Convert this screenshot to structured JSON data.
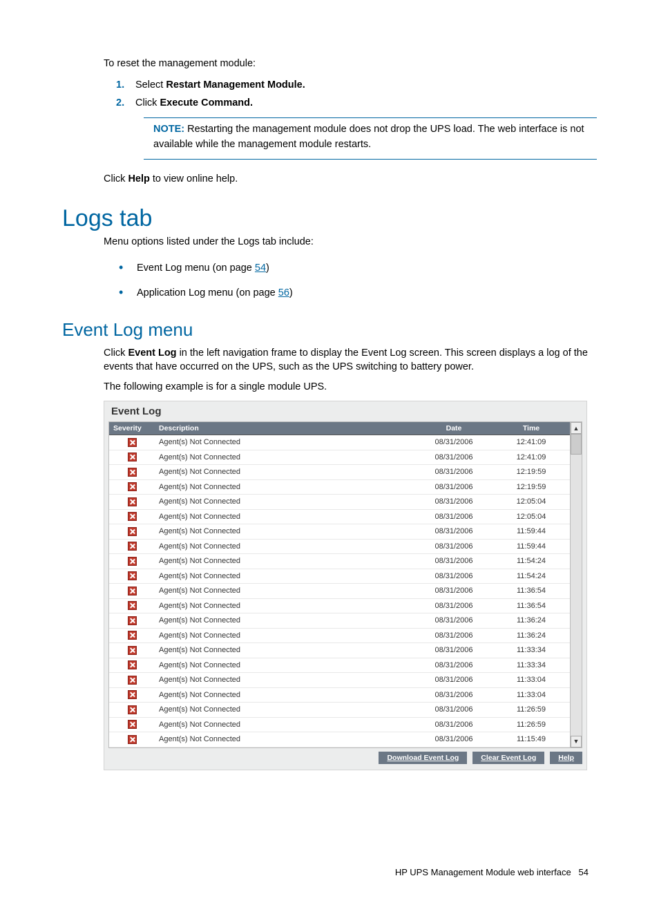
{
  "intro": {
    "reset_line": "To reset the management module:",
    "steps": [
      {
        "prefix": "Select ",
        "bold": "Restart Management Module."
      },
      {
        "prefix": "Click ",
        "bold": "Execute Command."
      }
    ],
    "note_label": "NOTE:",
    "note_text": "Restarting the management module does not drop the UPS load. The web interface is not available while the management module restarts.",
    "help_prefix": "Click ",
    "help_bold": "Help",
    "help_suffix": " to view online help."
  },
  "logs": {
    "heading": "Logs tab",
    "intro": "Menu options listed under the Logs tab include:",
    "bullets": [
      {
        "text": "Event Log menu (on page ",
        "link": "54",
        "suffix": ")"
      },
      {
        "text": "Application Log menu (on page ",
        "link": "56",
        "suffix": ")"
      }
    ]
  },
  "eventlog": {
    "heading": "Event Log menu",
    "p1_a": "Click ",
    "p1_b": "Event Log",
    "p1_c": " in the left navigation frame to display the Event Log screen. This screen displays a log of the events that have occurred on the UPS, such as the UPS switching to battery power.",
    "p2": "The following example is for a single module UPS."
  },
  "screenshot": {
    "title": "Event Log",
    "headers": {
      "severity": "Severity",
      "description": "Description",
      "date": "Date",
      "time": "Time"
    },
    "rows": [
      {
        "desc": "Agent(s) Not Connected",
        "date": "08/31/2006",
        "time": "12:41:09"
      },
      {
        "desc": "Agent(s) Not Connected",
        "date": "08/31/2006",
        "time": "12:41:09"
      },
      {
        "desc": "Agent(s) Not Connected",
        "date": "08/31/2006",
        "time": "12:19:59"
      },
      {
        "desc": "Agent(s) Not Connected",
        "date": "08/31/2006",
        "time": "12:19:59"
      },
      {
        "desc": "Agent(s) Not Connected",
        "date": "08/31/2006",
        "time": "12:05:04"
      },
      {
        "desc": "Agent(s) Not Connected",
        "date": "08/31/2006",
        "time": "12:05:04"
      },
      {
        "desc": "Agent(s) Not Connected",
        "date": "08/31/2006",
        "time": "11:59:44"
      },
      {
        "desc": "Agent(s) Not Connected",
        "date": "08/31/2006",
        "time": "11:59:44"
      },
      {
        "desc": "Agent(s) Not Connected",
        "date": "08/31/2006",
        "time": "11:54:24"
      },
      {
        "desc": "Agent(s) Not Connected",
        "date": "08/31/2006",
        "time": "11:54:24"
      },
      {
        "desc": "Agent(s) Not Connected",
        "date": "08/31/2006",
        "time": "11:36:54"
      },
      {
        "desc": "Agent(s) Not Connected",
        "date": "08/31/2006",
        "time": "11:36:54"
      },
      {
        "desc": "Agent(s) Not Connected",
        "date": "08/31/2006",
        "time": "11:36:24"
      },
      {
        "desc": "Agent(s) Not Connected",
        "date": "08/31/2006",
        "time": "11:36:24"
      },
      {
        "desc": "Agent(s) Not Connected",
        "date": "08/31/2006",
        "time": "11:33:34"
      },
      {
        "desc": "Agent(s) Not Connected",
        "date": "08/31/2006",
        "time": "11:33:34"
      },
      {
        "desc": "Agent(s) Not Connected",
        "date": "08/31/2006",
        "time": "11:33:04"
      },
      {
        "desc": "Agent(s) Not Connected",
        "date": "08/31/2006",
        "time": "11:33:04"
      },
      {
        "desc": "Agent(s) Not Connected",
        "date": "08/31/2006",
        "time": "11:26:59"
      },
      {
        "desc": "Agent(s) Not Connected",
        "date": "08/31/2006",
        "time": "11:26:59"
      },
      {
        "desc": "Agent(s) Not Connected",
        "date": "08/31/2006",
        "time": "11:15:49"
      }
    ],
    "buttons": {
      "download": "Download Event Log",
      "clear": "Clear Event Log",
      "help": "Help"
    }
  },
  "footer": {
    "text": "HP UPS Management Module web interface",
    "page": "54"
  }
}
